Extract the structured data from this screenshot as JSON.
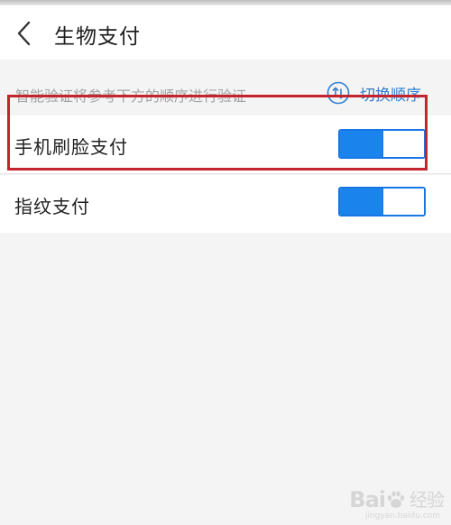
{
  "header": {
    "title": "生物支付",
    "back_icon": "chevron-left-icon"
  },
  "hint": {
    "text": "智能验证将参考下方的顺序进行验证",
    "switch_order_label": "切换顺序",
    "switch_order_icon": "swap-vertical-icon"
  },
  "settings": {
    "items": [
      {
        "label": "手机刷脸支付",
        "enabled": true
      },
      {
        "label": "指纹支付",
        "enabled": true
      }
    ]
  },
  "colors": {
    "accent": "#1a83ec",
    "link": "#2f7fd1",
    "highlight_border": "#c4252d",
    "page_background": "#f4f4f4"
  },
  "watermark": {
    "logo_left": "Bai",
    "logo_right": "经验",
    "subtitle": "jingyan.baidu.com"
  }
}
